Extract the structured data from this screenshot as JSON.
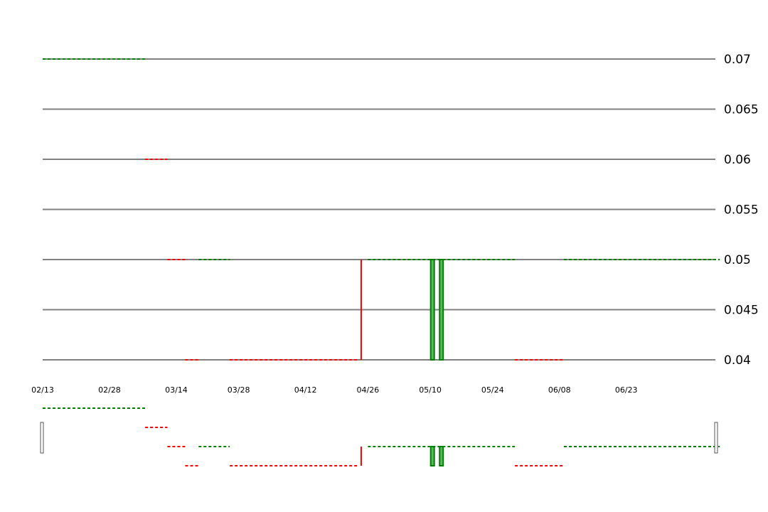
{
  "chart_data": {
    "type": "candlestick",
    "x_axis": {
      "type": "date",
      "ticks": [
        "02/13",
        "02/28",
        "03/14",
        "03/28",
        "04/12",
        "04/26",
        "05/10",
        "05/24",
        "06/08",
        "06/23"
      ],
      "range": [
        "02/13",
        "07/13"
      ]
    },
    "y_axis": {
      "position": "right",
      "ticks": [
        "0.07",
        "0.065",
        "0.06",
        "0.055",
        "0.05",
        "0.045",
        "0.04"
      ],
      "ylim": [
        0.04,
        0.07
      ],
      "grid": true
    },
    "colors": {
      "up": "#008000",
      "down": "#ff0000",
      "grid": "#808080"
    },
    "flat_segments": [
      {
        "start": "02/13",
        "end": "03/06",
        "value": 0.07,
        "color": "up"
      },
      {
        "start": "03/07",
        "end": "03/11",
        "value": 0.06,
        "color": "down"
      },
      {
        "start": "03/12",
        "end": "03/15",
        "value": 0.05,
        "color": "down"
      },
      {
        "start": "03/16",
        "end": "03/18",
        "value": 0.04,
        "color": "down"
      },
      {
        "start": "03/19",
        "end": "03/25",
        "value": 0.05,
        "color": "up"
      },
      {
        "start": "03/26",
        "end": "04/23",
        "value": 0.04,
        "color": "down"
      },
      {
        "start": "04/26",
        "end": "05/28",
        "value": 0.05,
        "color": "up"
      },
      {
        "start": "05/29",
        "end": "06/08",
        "value": 0.04,
        "color": "down"
      },
      {
        "start": "06/09",
        "end": "07/13",
        "value": 0.05,
        "color": "up"
      }
    ],
    "candles": [
      {
        "date": "04/24",
        "open": 0.05,
        "high": 0.05,
        "low": 0.04,
        "close": 0.04,
        "color": "down"
      },
      {
        "date": "05/10",
        "open": 0.04,
        "high": 0.05,
        "low": 0.04,
        "close": 0.05,
        "color": "up"
      },
      {
        "date": "05/12",
        "open": 0.04,
        "high": 0.05,
        "low": 0.04,
        "close": 0.05,
        "color": "up"
      }
    ],
    "navigator": {
      "present": true,
      "range": [
        "02/13",
        "07/13"
      ]
    }
  }
}
